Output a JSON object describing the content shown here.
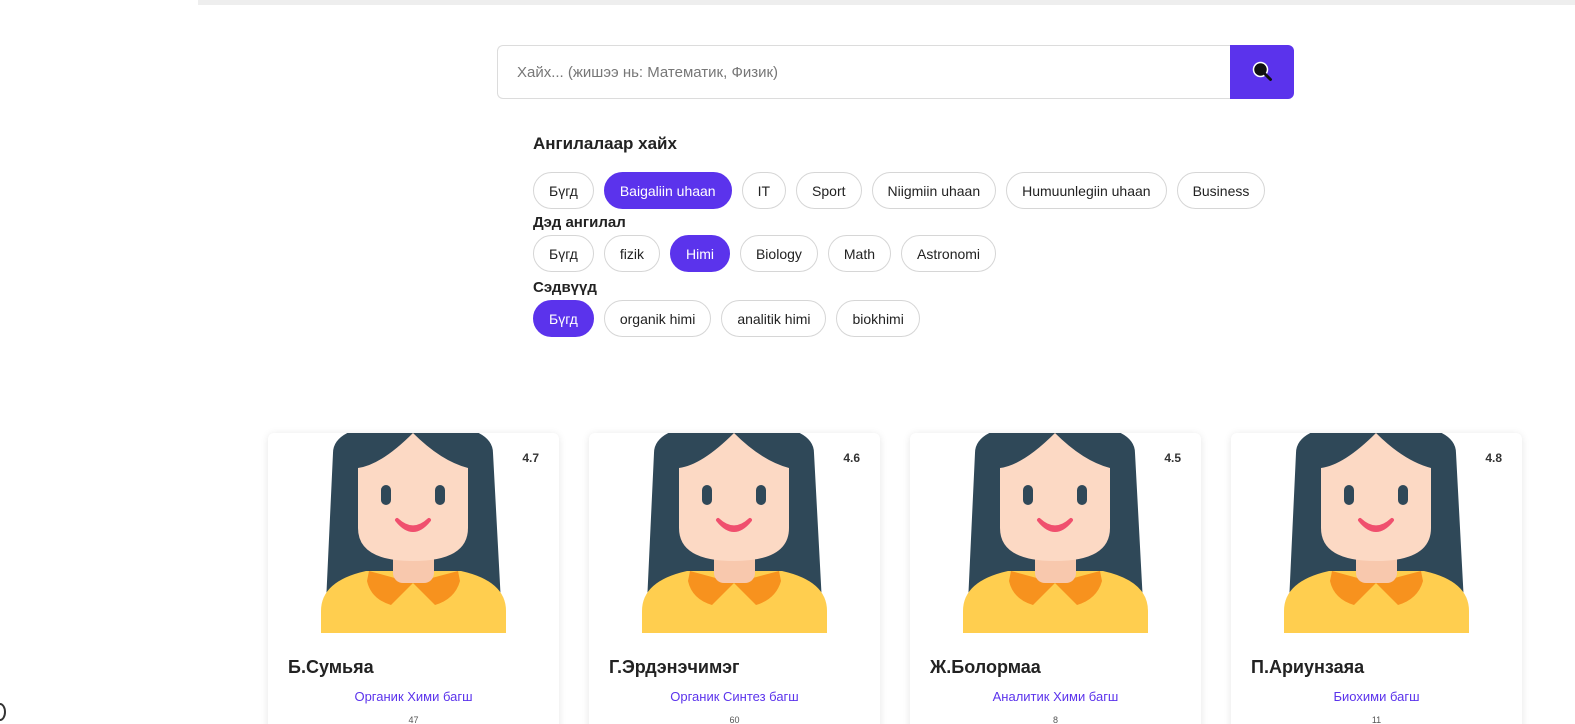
{
  "search": {
    "placeholder": "Хайх... (жишээ нь: Математик, Физик)",
    "icon": "search-icon"
  },
  "filters": {
    "category_title": "Ангилалаар хайх",
    "categories": [
      {
        "label": "Бүгд",
        "active": false
      },
      {
        "label": "Baigaliin uhaan",
        "active": true
      },
      {
        "label": "IT",
        "active": false
      },
      {
        "label": "Sport",
        "active": false
      },
      {
        "label": "Niigmiin uhaan",
        "active": false
      },
      {
        "label": "Humuunlegiin uhaan",
        "active": false
      },
      {
        "label": "Business",
        "active": false
      }
    ],
    "subcategory_title": "Дэд ангилал",
    "subcategories": [
      {
        "label": "Бүгд",
        "active": false
      },
      {
        "label": "fizik",
        "active": false
      },
      {
        "label": "Himi",
        "active": true
      },
      {
        "label": "Biology",
        "active": false
      },
      {
        "label": "Math",
        "active": false
      },
      {
        "label": "Astronomi",
        "active": false
      }
    ],
    "topics_title": "Сэдвүүд",
    "topics": [
      {
        "label": "Бүгд",
        "active": true
      },
      {
        "label": "organik himi",
        "active": false
      },
      {
        "label": "analitik himi",
        "active": false
      },
      {
        "label": "biokhimi",
        "active": false
      }
    ]
  },
  "teachers": [
    {
      "name": "Б.Сумьяа",
      "role": "Органик Хими багш",
      "rating": "4.7",
      "meta": "47"
    },
    {
      "name": "Г.Эрдэнэчимэг",
      "role": "Органик Синтез багш",
      "rating": "4.6",
      "meta": "60"
    },
    {
      "name": "Ж.Болормаа",
      "role": "Аналитик Хими багш",
      "rating": "4.5",
      "meta": "8"
    },
    {
      "name": "П.Ариунзаяа",
      "role": "Биохими багш",
      "rating": "4.8",
      "meta": "11"
    }
  ],
  "colors": {
    "accent": "#5b33ec",
    "avatar_hair": "#2f4858",
    "avatar_skin": "#fcd9c4",
    "avatar_shirt": "#ffce4f",
    "avatar_collar": "#f7921e",
    "avatar_mouth": "#f0506e"
  }
}
